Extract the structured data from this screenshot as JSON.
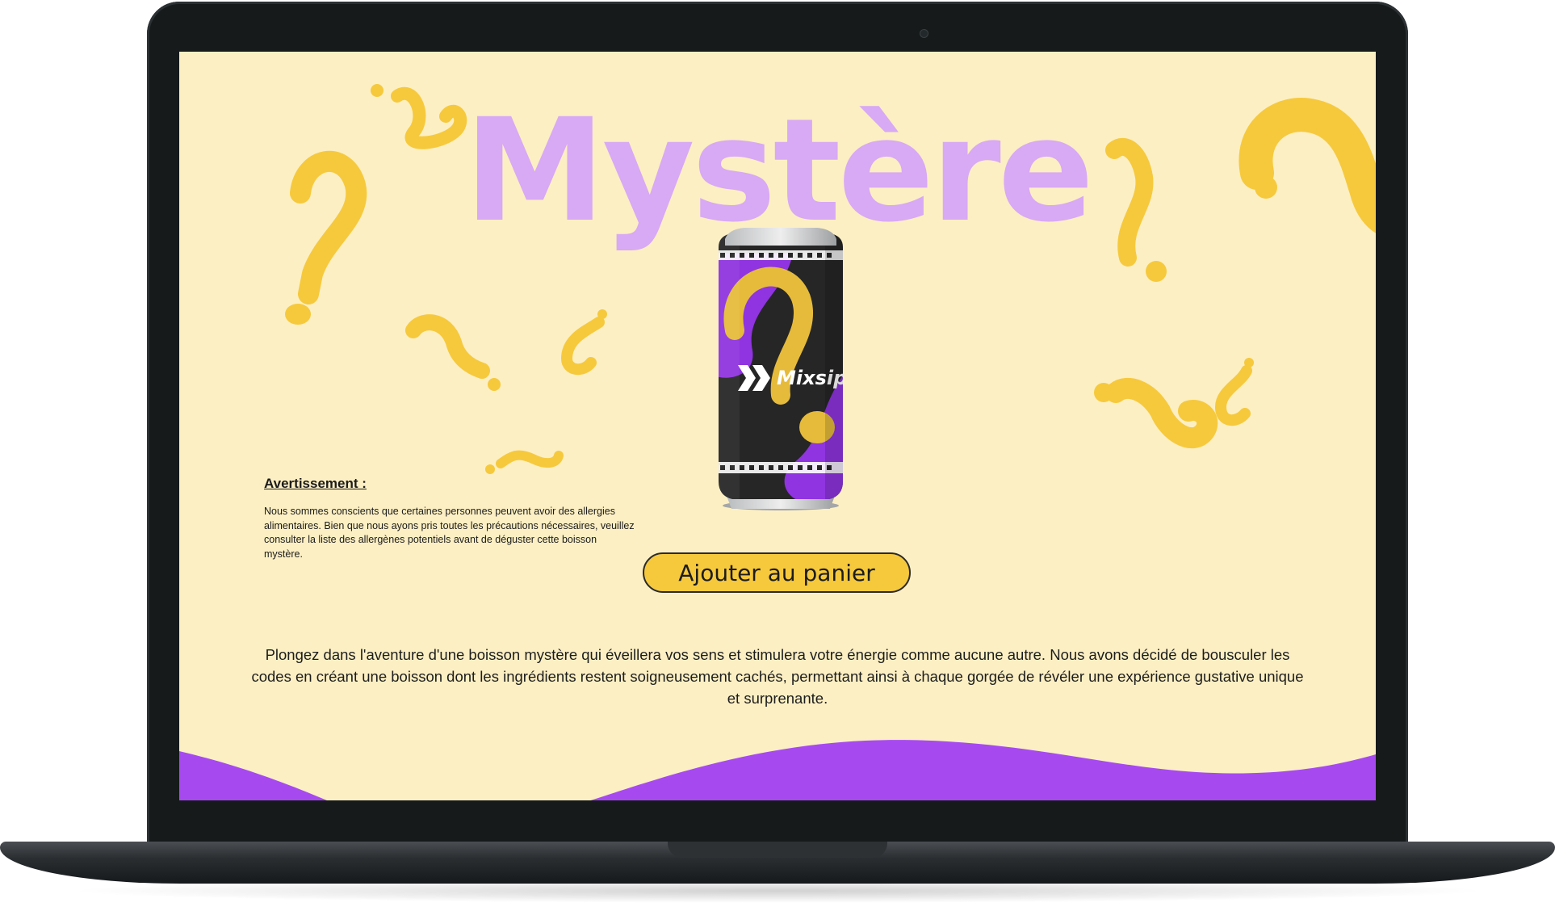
{
  "page": {
    "hero_title": "Mystère",
    "can_brand": "Mixsip",
    "warning": {
      "title": "Avertissement :",
      "text": "Nous sommes conscients que certaines personnes peuvent avoir des allergies alimentaires. Bien que nous ayons pris toutes les précautions nécessaires, veuillez consulter la liste des allergènes potentiels avant de déguster cette boisson mystère."
    },
    "cta_label": "Ajouter au panier",
    "description": "Plongez dans l'aventure d'une boisson mystère qui éveillera vos sens et stimulera votre énergie comme aucune autre. Nous avons décidé de bousculer les codes en créant une boisson dont les ingrédients restent soigneusement cachés, permettant ainsi à chaque gorgée de révéler une expérience gustative unique et surprenante."
  },
  "colors": {
    "background": "#fcefc3",
    "accent_yellow": "#f6c93d",
    "accent_purple": "#a64af0",
    "title_lilac": "#d8a9f4",
    "laptop_frame": "#161a1b"
  },
  "icons": [
    "question-mark-icon",
    "inverted-question-mark-icon",
    "logo-chevrons-icon"
  ]
}
